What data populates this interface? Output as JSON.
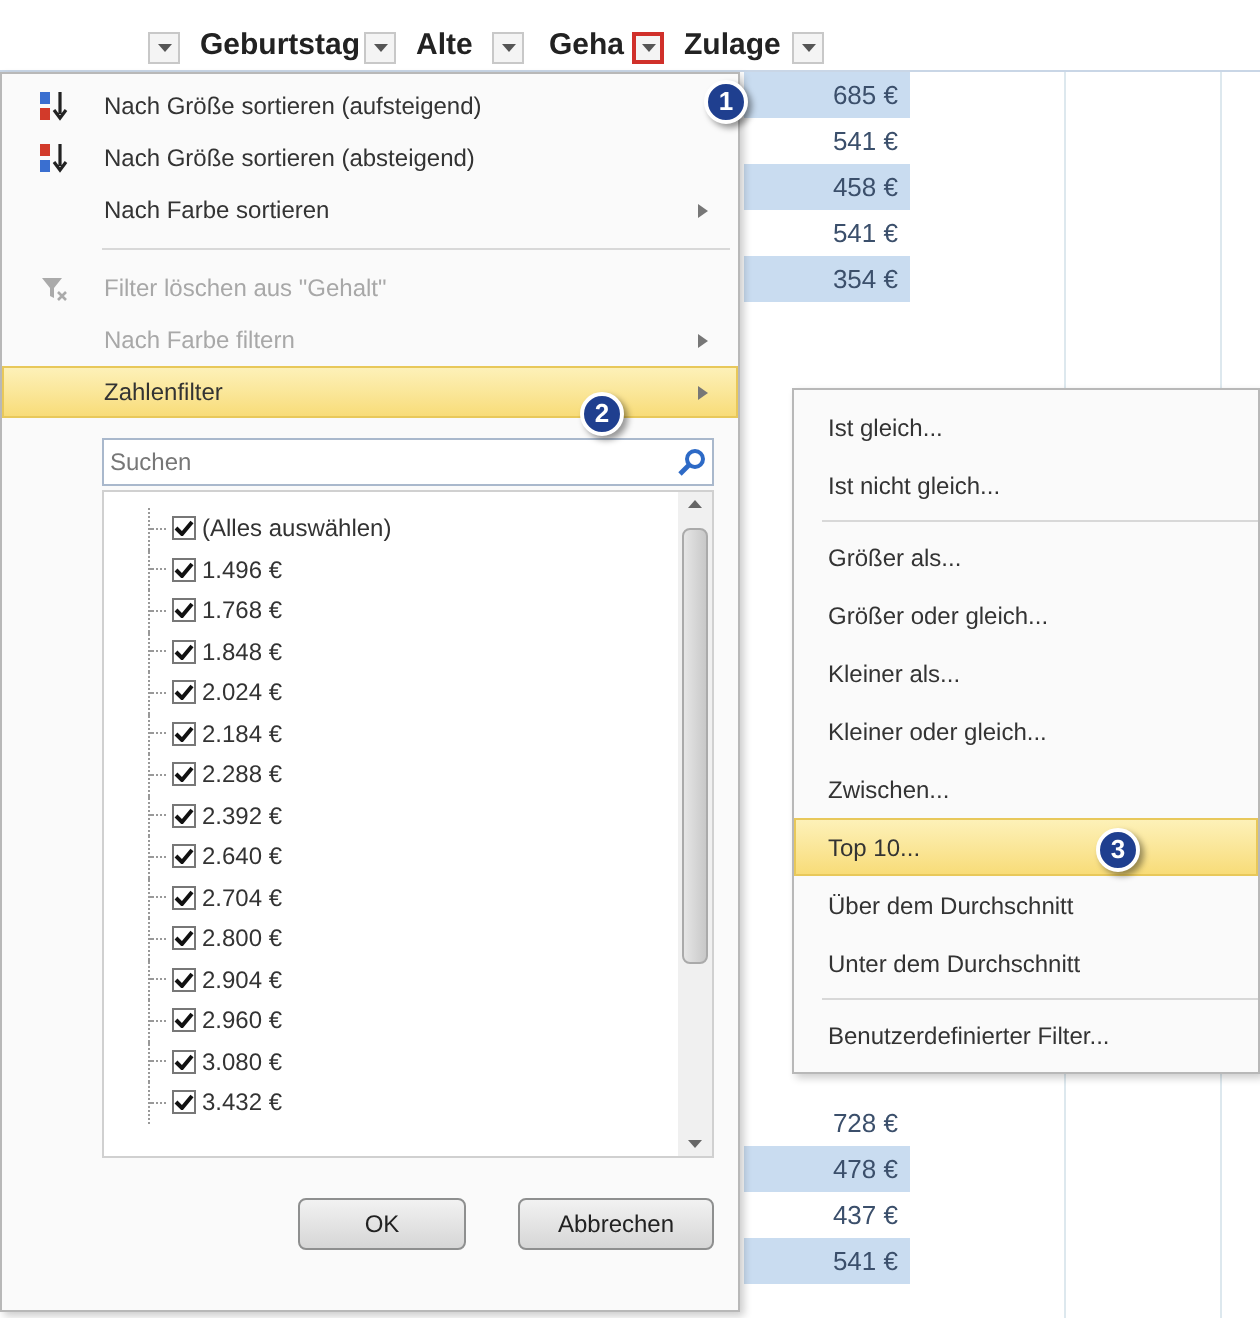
{
  "header": [
    {
      "active": false
    },
    {
      "label": "Geburtstag",
      "active": false
    },
    {
      "label": "Alte",
      "active": false
    },
    {
      "label": "Geha",
      "active": true
    },
    {
      "label": "Zulage",
      "active": false
    }
  ],
  "zulage_cells_top": [
    "685 €",
    "541 €",
    "458 €",
    "541 €",
    "354 €"
  ],
  "zulage_cells_bottom": [
    "728 €",
    "478 €",
    "437 €",
    "541 €"
  ],
  "callouts": [
    "1",
    "2",
    "3"
  ],
  "menu": [
    {
      "kind": "item",
      "label": "Nach Größe sortieren (aufsteigend)",
      "disabled": false,
      "submenu": false,
      "highlighted": false
    },
    {
      "kind": "item",
      "label": "Nach Größe sortieren (absteigend)",
      "disabled": false,
      "submenu": false,
      "highlighted": false
    },
    {
      "kind": "item",
      "label": "Nach Farbe sortieren",
      "disabled": false,
      "submenu": true,
      "highlighted": false
    },
    {
      "kind": "separator"
    },
    {
      "kind": "item",
      "label": "Filter löschen aus \"Gehalt\"",
      "disabled": true,
      "submenu": false,
      "highlighted": false
    },
    {
      "kind": "item",
      "label": "Nach Farbe filtern",
      "disabled": true,
      "submenu": true,
      "highlighted": false
    },
    {
      "kind": "item",
      "label": "Zahlenfilter",
      "disabled": false,
      "submenu": true,
      "highlighted": true
    }
  ],
  "search": {
    "placeholder": "Suchen"
  },
  "filter_values": [
    {
      "label": "(Alles auswählen)",
      "checked": true
    },
    {
      "label": "1.496 €",
      "checked": true
    },
    {
      "label": "1.768 €",
      "checked": true
    },
    {
      "label": "1.848 €",
      "checked": true
    },
    {
      "label": "2.024 €",
      "checked": true
    },
    {
      "label": "2.184 €",
      "checked": true
    },
    {
      "label": "2.288 €",
      "checked": true
    },
    {
      "label": "2.392 €",
      "checked": true
    },
    {
      "label": "2.640 €",
      "checked": true
    },
    {
      "label": "2.704 €",
      "checked": true
    },
    {
      "label": "2.800 €",
      "checked": true
    },
    {
      "label": "2.904 €",
      "checked": true
    },
    {
      "label": "2.960 €",
      "checked": true
    },
    {
      "label": "3.080 €",
      "checked": true
    },
    {
      "label": "3.432 €",
      "checked": true
    }
  ],
  "buttons": [
    "OK",
    "Abbrechen"
  ],
  "submenu": [
    {
      "kind": "item",
      "label": "Ist gleich...",
      "highlighted": false
    },
    {
      "kind": "item",
      "label": "Ist nicht gleich...",
      "highlighted": false
    },
    {
      "kind": "separator"
    },
    {
      "kind": "item",
      "label": "Größer als...",
      "highlighted": false
    },
    {
      "kind": "item",
      "label": "Größer oder gleich...",
      "highlighted": false
    },
    {
      "kind": "item",
      "label": "Kleiner als...",
      "highlighted": false
    },
    {
      "kind": "item",
      "label": "Kleiner oder gleich...",
      "highlighted": false
    },
    {
      "kind": "item",
      "label": "Zwischen...",
      "highlighted": false
    },
    {
      "kind": "item",
      "label": "Top 10...",
      "highlighted": true
    },
    {
      "kind": "item",
      "label": "Über dem Durchschnitt",
      "highlighted": false
    },
    {
      "kind": "item",
      "label": "Unter dem Durchschnitt",
      "highlighted": false
    },
    {
      "kind": "separator"
    },
    {
      "kind": "item",
      "label": "Benutzerdefinierter Filter...",
      "highlighted": false
    }
  ]
}
